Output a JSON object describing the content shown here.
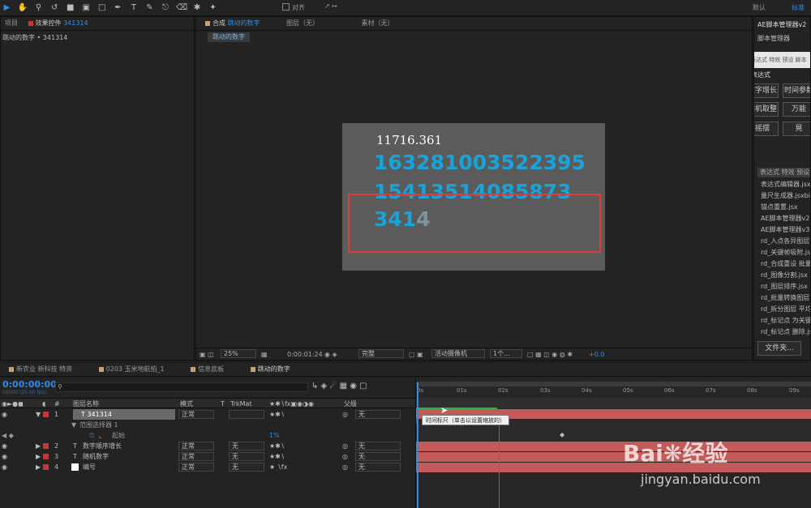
{
  "toolbar": {
    "snap_label": "对齐",
    "workspace_default": "默认",
    "workspace_standard": "标准"
  },
  "project_panel": {
    "tab_project": "项目",
    "tab_effects": "效果控件",
    "effects_layer": "341314",
    "breadcrumb": "跳动的数字 • 341314"
  },
  "comp_panel": {
    "tab_comp_prefix": "合成",
    "tab_comp_name": "跳动的数字",
    "tab_layer": "图层（无）",
    "tab_footage": "素材（无）",
    "active_comp_chip": "跳动的数字",
    "zoom": "25%",
    "timecode": "0:00:01:24",
    "quality": "完整",
    "camera": "活动摄像机",
    "views": "1个...",
    "exposure": "+0.0"
  },
  "canvas": {
    "text_small": "11716.361",
    "line1": "1632810035223​95",
    "line2": "15413514085873",
    "line3_main": "341",
    "line3_fade": "4"
  },
  "script_panel": {
    "title": "AE脚本管理器v2",
    "subtitle": "脚本管理器",
    "tabs_row": "表达式 特效 预设 脚本",
    "section": "表达式",
    "buttons": [
      "数字增长",
      "时间参数",
      "随机取整",
      "万能",
      "摇摆",
      "晃"
    ],
    "list_header": "表达式 特效 预设",
    "items": [
      "表达式编辑器.jsx",
      "量尺生成器.jsxbin",
      "锚点重置.jsx",
      "AE脚本管理器v2",
      "AE脚本管理器v3",
      "rd_入点各异图层",
      "rd_关键帧吸附.jsx",
      "rd_合成重设 批量",
      "rd_图像分割.jsx",
      "rd_图层排序.jsx",
      "rd_批量转换图层",
      "rd_拆分图层 平均",
      "rd_标记点 为关键",
      "rd_标记点 删除.js"
    ],
    "folder_button": "文件夹..."
  },
  "timeline_tabs": [
    "新农业 新科技 特资",
    "0203 玉米地航拍_1",
    "信息底板",
    "跳动的数字"
  ],
  "timeline": {
    "timecode": "0:00:00:00",
    "fps": "00000 (25.00 fps)",
    "col_name": "图层名称",
    "col_mode": "模式",
    "col_t": "T",
    "col_trkmat": "TrkMat",
    "col_parent": "父级",
    "col_num": "#",
    "layers": [
      {
        "num": "1",
        "type": "T",
        "name": "341314",
        "mode": "正常",
        "trkmat": "",
        "parent": "无"
      },
      {
        "num": "2",
        "type": "T",
        "name": "数字顺序增长",
        "mode": "正常",
        "trkmat": "无",
        "parent": "无"
      },
      {
        "num": "3",
        "type": "T",
        "name": "随机数字",
        "mode": "正常",
        "trkmat": "无",
        "parent": "无"
      },
      {
        "num": "4",
        "type": "",
        "name": "编号",
        "mode": "正常",
        "trkmat": "无",
        "parent": "无"
      }
    ],
    "sub_selector": "范围选择器 1",
    "sub_offset": "起始",
    "sub_value": "1%",
    "ruler": [
      "0s",
      "01s",
      "02s",
      "03s",
      "04s",
      "05s",
      "06s",
      "07s",
      "08s",
      "09s"
    ],
    "tooltip": "时间标尺（单击以设置缩放的）",
    "cti_mark": "I"
  },
  "watermark": {
    "brand": "Bai",
    "brand2": "经验",
    "url": "jingyan.baidu.com"
  },
  "colors": {
    "accent": "#2d8ceb",
    "number_text": "#1aa3d9",
    "track": "#c25a5a",
    "highlight_box": "#e03a3a"
  }
}
